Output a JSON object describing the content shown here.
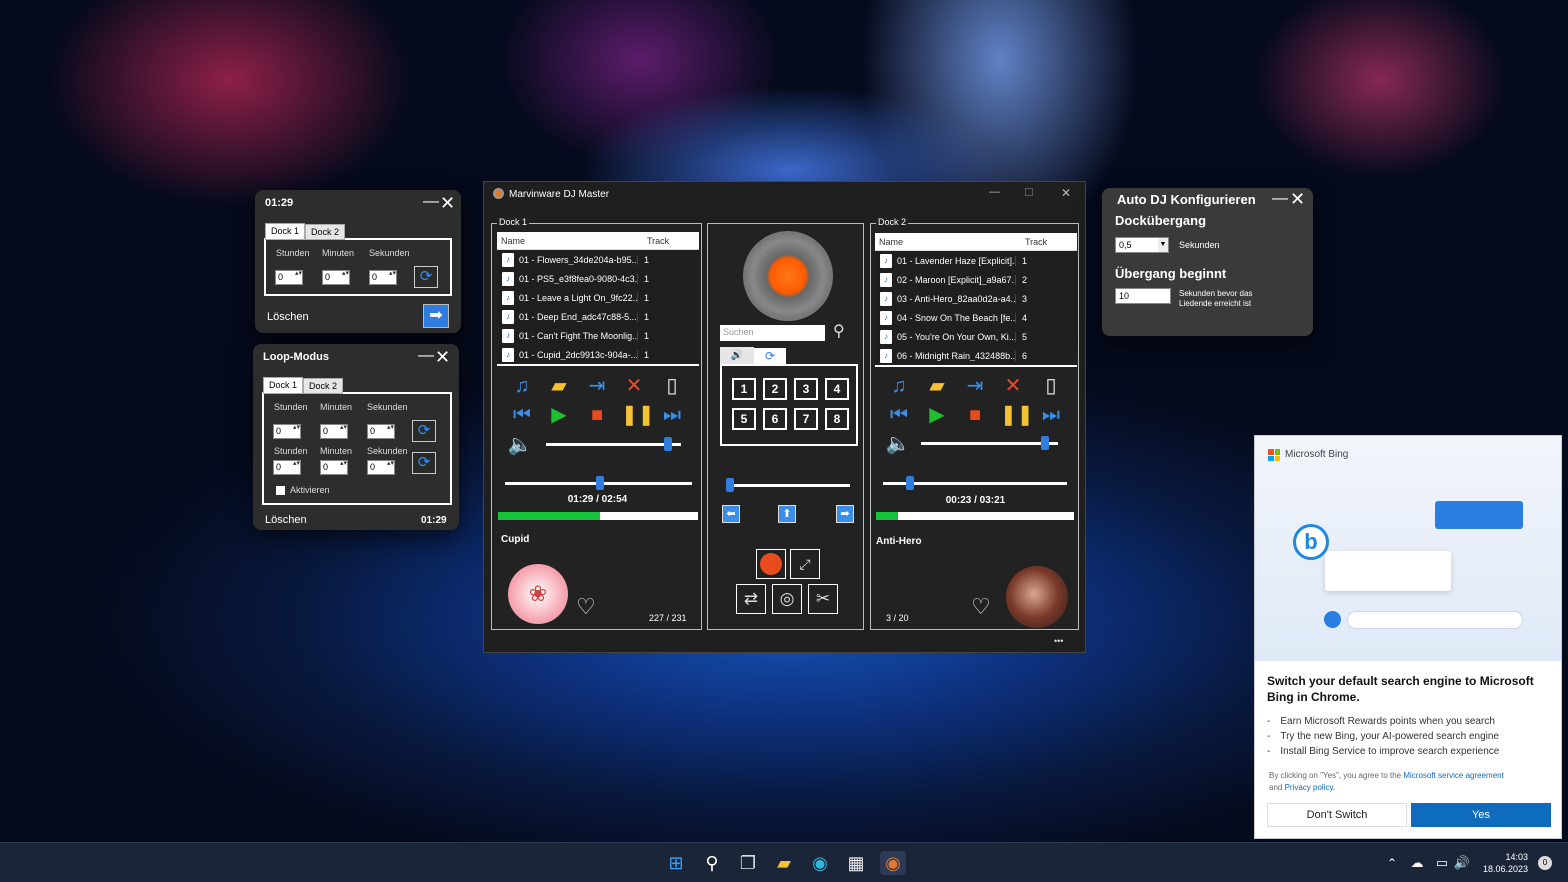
{
  "timer": {
    "time": "01:29",
    "tab1": "Dock 1",
    "tab2": "Dock 2",
    "h": "Stunden",
    "m": "Minuten",
    "s": "Sekunden",
    "v0": "0",
    "delete": "Löschen"
  },
  "loop": {
    "title": "Loop-Modus",
    "tab1": "Dock 1",
    "tab2": "Dock 2",
    "h": "Stunden",
    "m": "Minuten",
    "s": "Sekunden",
    "v0": "0",
    "activate": "Aktivieren",
    "delete": "Löschen",
    "time": "01:29"
  },
  "main": {
    "title": "Marvinware DJ Master",
    "minimize": "—",
    "maximize": "☐",
    "close": "✕",
    "more": "•••"
  },
  "dock1": {
    "label": "Dock 1",
    "col_name": "Name",
    "col_track": "Track",
    "rows": [
      {
        "name": "01 - Flowers_34de204a-b95...",
        "track": "1"
      },
      {
        "name": "01 - PS5_e3f8fea0-9080-4c3...",
        "track": "1"
      },
      {
        "name": "01 - Leave a Light On_9fc22...",
        "track": "1"
      },
      {
        "name": "01 - Deep End_adc47c88-5...",
        "track": "1"
      },
      {
        "name": "01 - Can't Fight The Moonlig...",
        "track": "1"
      },
      {
        "name": "01 - Cupid_2dc9913c-904a-...",
        "track": "1"
      }
    ],
    "time": "01:29 / 02:54",
    "song": "Cupid",
    "count": "227 / 231",
    "progress": 0.51,
    "volume": 0.93,
    "pos": 0.51
  },
  "dock2": {
    "label": "Dock 2",
    "col_name": "Name",
    "col_track": "Track",
    "rows": [
      {
        "name": "01 - Lavender Haze [Explicit]...",
        "track": "1"
      },
      {
        "name": "02 - Maroon [Explicit]_a9a67...",
        "track": "2"
      },
      {
        "name": "03 - Anti-Hero_82aa0d2a-a4...",
        "track": "3"
      },
      {
        "name": "04 - Snow On The Beach [fe...",
        "track": "4"
      },
      {
        "name": "05 - You're On Your Own, Ki...",
        "track": "5"
      },
      {
        "name": "06 - Midnight Rain_432488b...",
        "track": "6"
      }
    ],
    "time": "00:23 / 03:21",
    "song": "Anti-Hero",
    "count": "3 / 20",
    "progress": 0.11,
    "volume": 0.93,
    "pos": 0.13
  },
  "center": {
    "search_placeholder": "Suchen",
    "pads": [
      "1",
      "2",
      "3",
      "4",
      "5",
      "6",
      "7",
      "8"
    ]
  },
  "autodj": {
    "title": "Auto DJ Konfigurieren",
    "h1": "Docküberg​ang",
    "val1": "0,5",
    "unit1": "Sekunden",
    "h2": "Übergang beginnt",
    "val2": "10",
    "unit2a": "Sekunden bevor das",
    "unit2b": "Liedende erreicht ist"
  },
  "bing": {
    "brand": "Microsoft Bing",
    "headline": "Switch your default search engine to Microsoft Bing in Chrome.",
    "bullets": [
      "Earn Microsoft Rewards points when you search",
      "Try the new Bing, your AI-powered search engine",
      "Install Bing Service to improve search experience"
    ],
    "legal1": "By clicking on \"Yes\", you agree to the ",
    "legal_link1": "Microsoft service agreement",
    "legal2": "and ",
    "legal_link2": "Privacy policy.",
    "no": "Don't Switch",
    "yes": "Yes",
    "accent": "#0f6cbd"
  },
  "taskbar": {
    "time": "14:03",
    "date": "18.06.2023",
    "badge": "0"
  }
}
